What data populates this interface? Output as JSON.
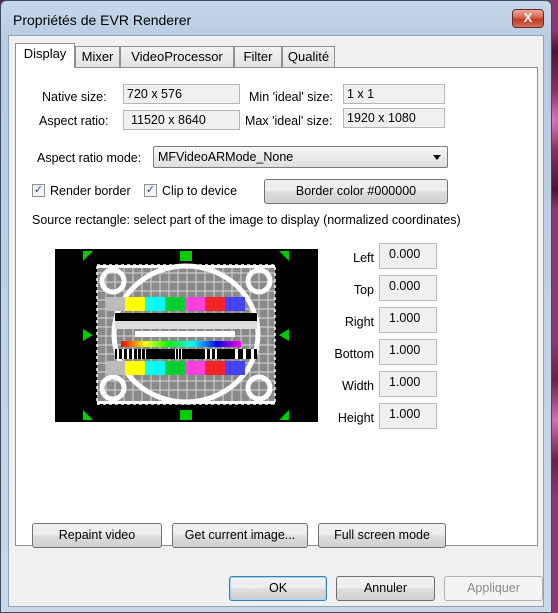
{
  "window": {
    "title": "Propriétés de EVR Renderer",
    "close_glyph": "X"
  },
  "tabs": [
    {
      "label": "Display",
      "active": true
    },
    {
      "label": "Mixer"
    },
    {
      "label": "VideoProcessor"
    },
    {
      "label": "Filter"
    },
    {
      "label": "Qualité"
    }
  ],
  "display": {
    "native_size_label": "Native size:",
    "native_size_value": "720 x 576",
    "aspect_ratio_label": "Aspect ratio:",
    "aspect_ratio_value": "11520 x 8640",
    "min_ideal_label": "Min 'ideal' size:",
    "min_ideal_value": "1 x 1",
    "max_ideal_label": "Max 'ideal' size:",
    "max_ideal_value": "1920 x 1080",
    "aspect_mode_label": "Aspect ratio mode:",
    "aspect_mode_value": "MFVideoARMode_None",
    "render_border_label": "Render border",
    "render_border_checked": true,
    "clip_to_device_label": "Clip to device",
    "clip_to_device_checked": true,
    "border_color_button": "Border color  #000000",
    "source_rect_caption": "Source rectangle: select part of the image to display (normalized coordinates)",
    "rect": [
      {
        "label": "Left",
        "value": "0.000"
      },
      {
        "label": "Top",
        "value": "0.000"
      },
      {
        "label": "Right",
        "value": "1.000"
      },
      {
        "label": "Bottom",
        "value": "1.000"
      },
      {
        "label": "Width",
        "value": "1.000"
      },
      {
        "label": "Height",
        "value": "1.000"
      }
    ],
    "buttons": {
      "repaint": "Repaint video",
      "get_image": "Get current image...",
      "full_screen": "Full screen mode"
    }
  },
  "footer": {
    "ok": "OK",
    "cancel": "Annuler",
    "apply": "Appliquer"
  },
  "colors": {
    "handle": "#00cc00",
    "check": "#2b4a7a",
    "default_button_border": "#3c7fb1"
  }
}
